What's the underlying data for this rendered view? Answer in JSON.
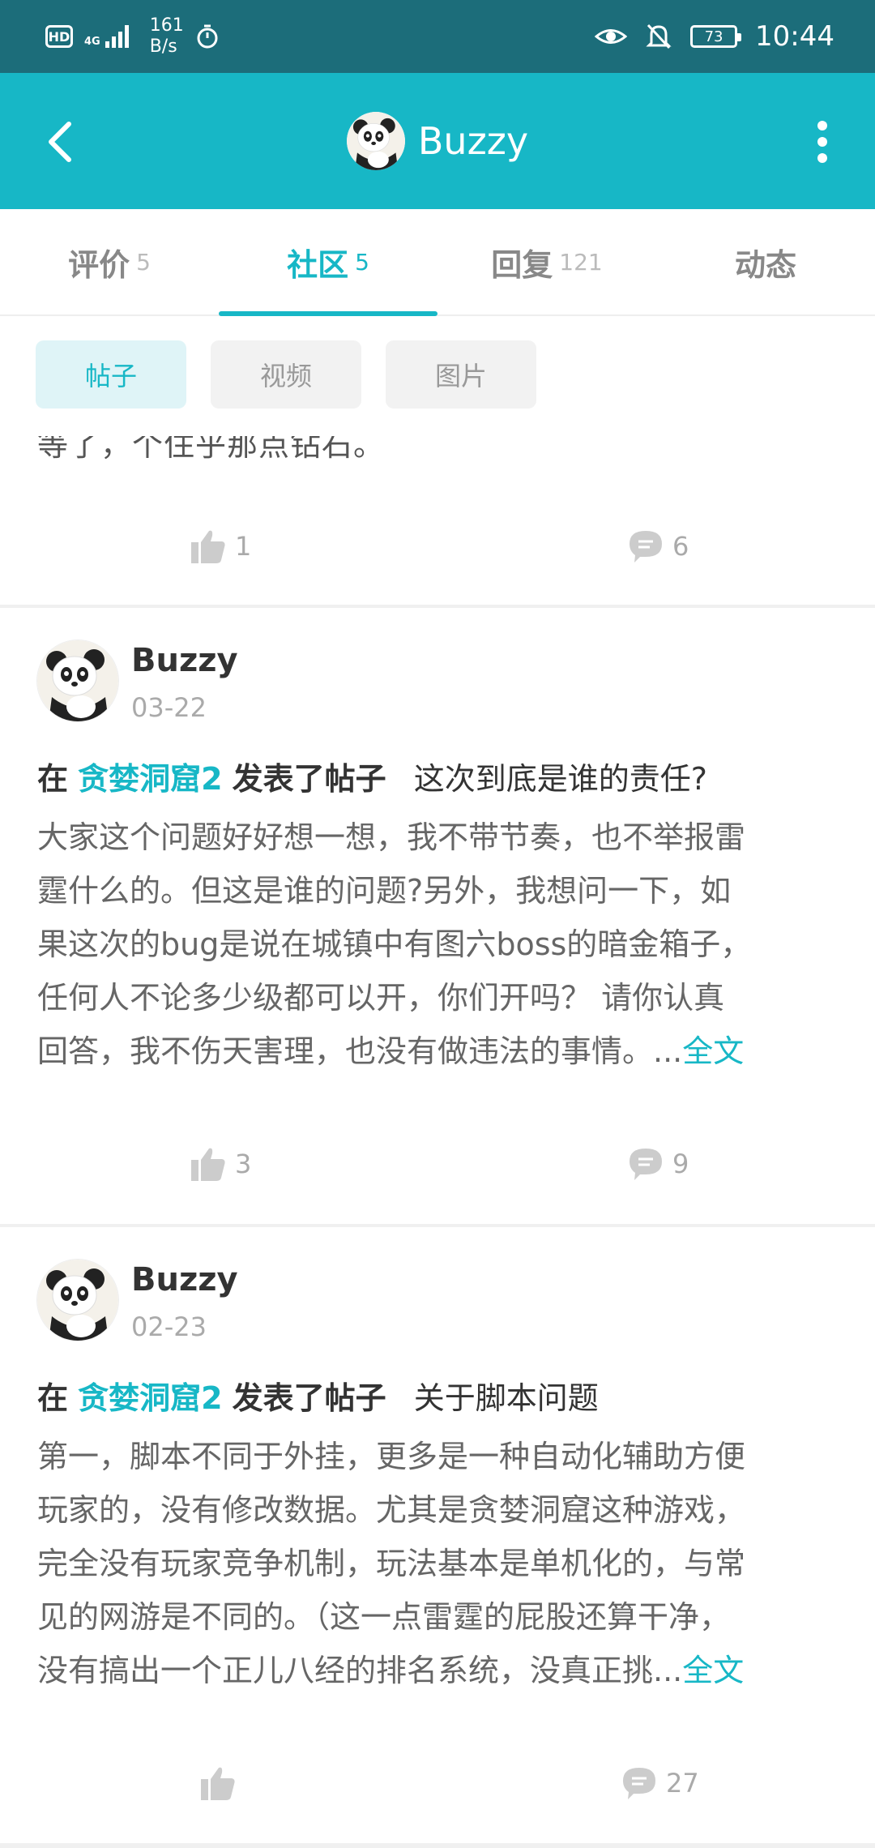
{
  "status_bar": {
    "hd": "HD",
    "network": "4G",
    "speed_value": "161",
    "speed_unit": "B/s",
    "battery": "73",
    "time": "10:44"
  },
  "app_bar": {
    "title": "Buzzy",
    "icons": [
      "back-icon",
      "avatar",
      "more-vertical-icon"
    ]
  },
  "tabs": [
    {
      "label": "评价",
      "count": "5"
    },
    {
      "label": "社区",
      "count": "5",
      "active": true
    },
    {
      "label": "回复",
      "count": "121"
    },
    {
      "label": "动态",
      "count": ""
    }
  ],
  "filters": [
    {
      "label": "帖子",
      "active": true
    },
    {
      "label": "视频"
    },
    {
      "label": "图片"
    }
  ],
  "partial_post": {
    "text": "等了，个住乎那点钻石。",
    "likes": "1",
    "comments": "6"
  },
  "posts": [
    {
      "author": "Buzzy",
      "date": "03-22",
      "prefix": "在",
      "game": "贪婪洞窟2",
      "action": "发表了帖子",
      "title": "这次到底是谁的责任?",
      "lines": [
        "大家这个问题好好想一想，我不带节奏，也不举报雷",
        "霆什么的。但这是谁的问题?另外，我想问一下，如",
        "果这次的bug是说在城镇中有图六boss的暗金箱子，",
        "任何人不论多少级都可以开，你们开吗？ 请你认真",
        "回答，我不伤天害理，也没有做违法的事情。..."
      ],
      "more": "全文",
      "likes": "3",
      "comments": "9"
    },
    {
      "author": "Buzzy",
      "date": "02-23",
      "prefix": "在",
      "game": "贪婪洞窟2",
      "action": "发表了帖子",
      "title": "关于脚本问题",
      "lines": [
        "第一，脚本不同于外挂，更多是一种自动化辅助方便",
        "玩家的，没有修改数据。尤其是贪婪洞窟这种游戏，",
        "完全没有玩家竞争机制，玩法基本是单机化的，与常",
        "见的网游是不同的。（这一点雷霆的屁股还算干净，",
        "没有搞出一个正儿八经的排名系统，没真正挑..."
      ],
      "more": "全文",
      "likes": "",
      "comments": "27"
    }
  ],
  "colors": {
    "status_bar": "#1c6d7a",
    "accent": "#17b7c6",
    "text_muted": "#aaaaaa"
  }
}
